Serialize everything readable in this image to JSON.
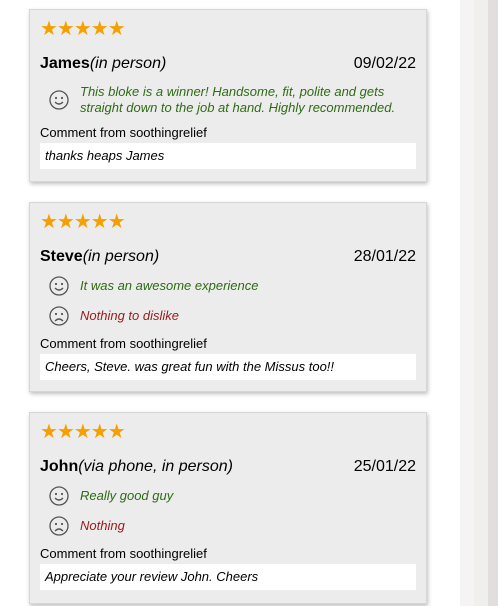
{
  "reviews": [
    {
      "stars": "★★★★★",
      "name": "James",
      "method": "(in person)",
      "date": "09/02/22",
      "like": "This bloke is a winner! Handsome, fit, polite and gets straight down to the job at hand. Highly recommended.",
      "comment_label": "Comment from soothingrelief",
      "reply": "thanks heaps James"
    },
    {
      "stars": "★★★★★",
      "name": "Steve",
      "method": "(in person)",
      "date": "28/01/22",
      "like": "It was an awesome experience",
      "dislike": "Nothing to dislike",
      "comment_label": "Comment from soothingrelief",
      "reply": "Cheers, Steve. was great fun with the Missus too!!"
    },
    {
      "stars": "★★★★★",
      "name": "John",
      "method": "(via phone, in person)",
      "date": "25/01/22",
      "like": "Really good guy",
      "dislike": "Nothing",
      "comment_label": "Comment from soothingrelief",
      "reply": "Appreciate your review John. Cheers"
    }
  ],
  "colors": {
    "star": "#f5a000",
    "like": "#2e6b14",
    "dislike": "#9a1a1a",
    "card": "#ececec"
  },
  "icons": {
    "like": "smiley-face-icon",
    "dislike": "sad-face-icon",
    "rating": "star-icon"
  }
}
